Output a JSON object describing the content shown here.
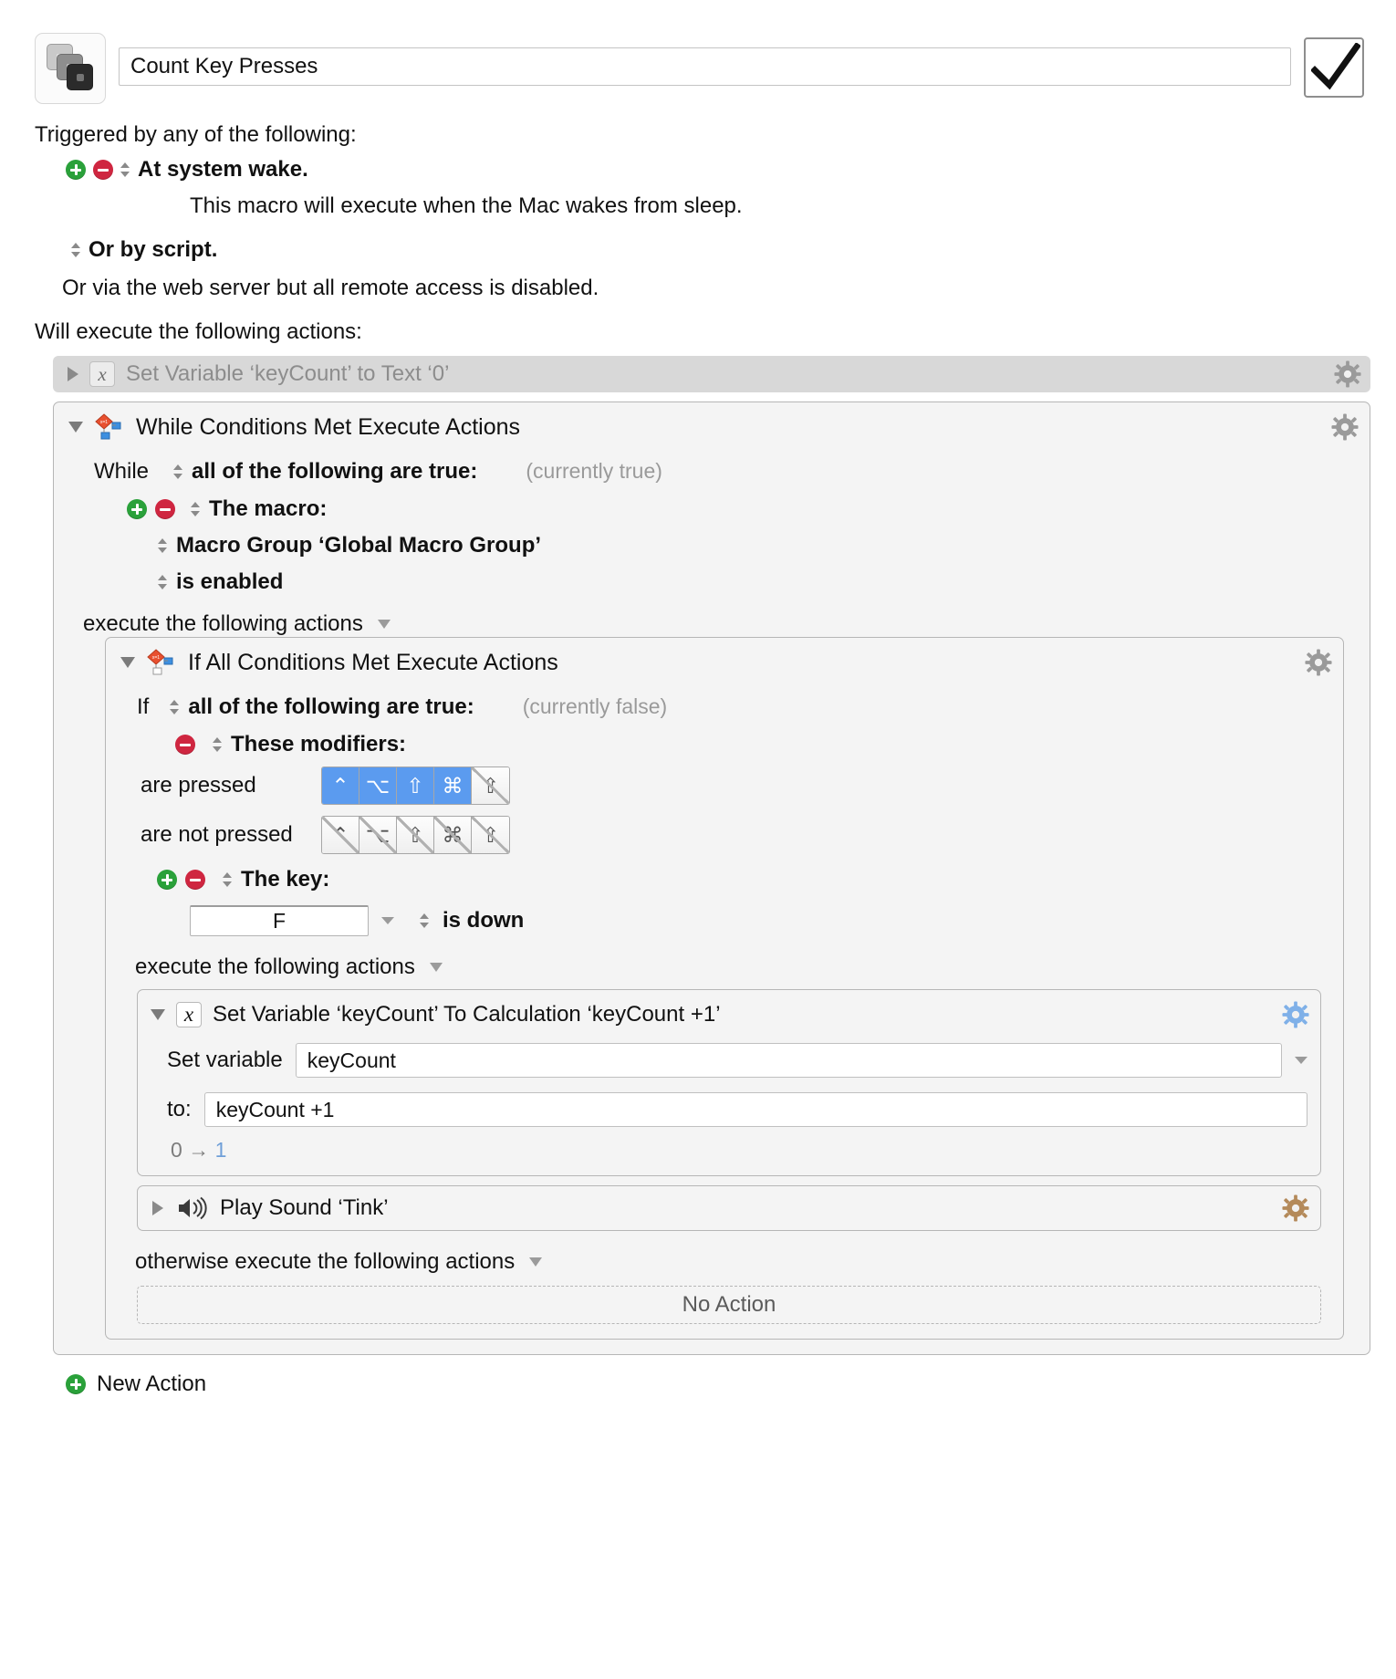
{
  "header": {
    "macro_name": "Count Key Presses",
    "macro_icon": "stacked-keys-icon",
    "enabled_checkbox": "checked"
  },
  "triggers": {
    "section_label": "Triggered by any of the following:",
    "items": [
      {
        "label": "At system wake.",
        "description": "This macro will execute when the Mac wakes from sleep.",
        "has_add": true,
        "has_remove": true
      },
      {
        "label": "Or by script.",
        "has_add": false,
        "has_remove": false
      }
    ],
    "note": "Or via the web server but all remote access is disabled."
  },
  "actions_section": {
    "label": "Will execute the following actions:"
  },
  "action1": {
    "title": "Set Variable ‘keyCount’ to Text ‘0’",
    "icon": "variable-x-icon",
    "disabled": true,
    "disclosure": "collapsed"
  },
  "while_block": {
    "title": "While Conditions Met Execute Actions",
    "icon": "flow-diamond-icon",
    "disclosure": "expanded",
    "keyword": "While",
    "match_mode": "all of the following are true:",
    "currently": "(currently true)",
    "conditions": [
      {
        "label": "The macro:",
        "has_add": true,
        "has_remove": true
      },
      {
        "label": "Macro Group ‘Global Macro Group’"
      },
      {
        "label": "is enabled"
      }
    ],
    "exec_label": "execute the following actions"
  },
  "if_block": {
    "title": "If All Conditions Met Execute Actions",
    "icon": "flow-diamond-icon",
    "disclosure": "expanded",
    "keyword": "If",
    "match_mode": "all of the following are true:",
    "currently": "(currently false)",
    "modifier_condition": {
      "label": "These modifiers:",
      "has_add": false,
      "has_remove": true,
      "pressed_label": "are pressed",
      "not_pressed_label": "are not pressed",
      "pressed": [
        {
          "name": "control",
          "glyph": "⌃",
          "selected": true
        },
        {
          "name": "option",
          "glyph": "⌥",
          "selected": true
        },
        {
          "name": "shift",
          "glyph": "⇧",
          "selected": true
        },
        {
          "name": "command",
          "glyph": "⌘",
          "selected": true
        },
        {
          "name": "fn",
          "glyph": "⇧",
          "selected": false
        }
      ],
      "not_pressed": [
        {
          "name": "control",
          "glyph": "⌃",
          "selected": false
        },
        {
          "name": "option",
          "glyph": "⌥",
          "selected": false
        },
        {
          "name": "shift",
          "glyph": "⇧",
          "selected": false
        },
        {
          "name": "command",
          "glyph": "⌘",
          "selected": false
        },
        {
          "name": "fn",
          "glyph": "⇧",
          "selected": false
        }
      ]
    },
    "key_condition": {
      "label": "The key:",
      "has_add": true,
      "has_remove": true,
      "key_value": "F",
      "state": "is down"
    },
    "exec_label": "execute the following actions",
    "otherwise_label": "otherwise execute the following actions",
    "no_action_label": "No Action"
  },
  "set_variable_action": {
    "title": "Set Variable ‘keyCount’ To Calculation ‘keyCount +1’",
    "icon": "variable-x-icon",
    "disclosure": "expanded",
    "set_variable_label": "Set variable",
    "variable_name": "keyCount",
    "to_label": "to:",
    "expression": "keyCount +1",
    "result_from": "0",
    "result_arrow": "→",
    "result_to": "1"
  },
  "play_sound_action": {
    "title": "Play Sound ‘Tink’",
    "icon": "speaker-icon",
    "disclosure": "collapsed"
  },
  "footer": {
    "new_action_label": "New Action"
  },
  "colors": {
    "add_green": "#2aa13a",
    "remove_red": "#cf2640",
    "modifier_selected_blue": "#5b9bef",
    "disabled_gray": "#8d8d8d",
    "result_blue": "#6f9fd8"
  }
}
